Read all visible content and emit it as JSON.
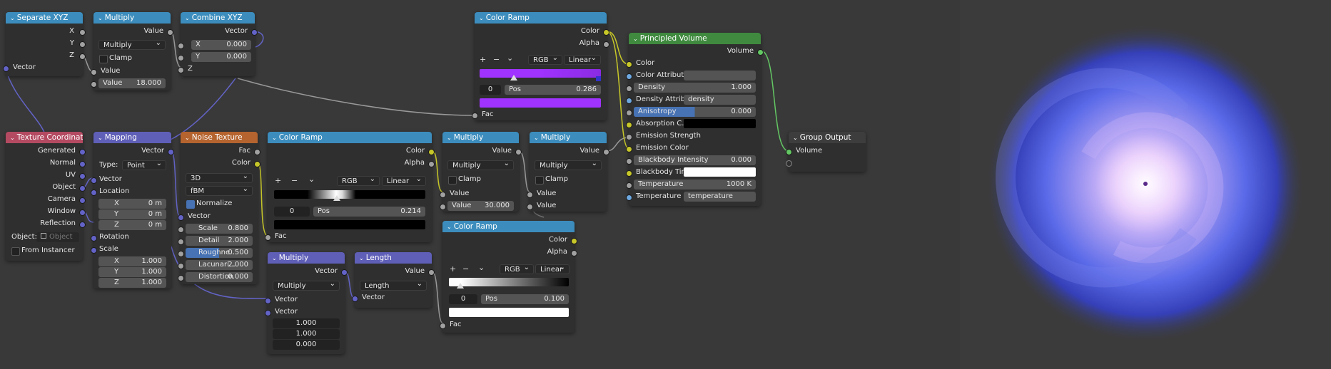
{
  "colors": {
    "conv_header": "#3c8dbd",
    "vector_header": "#5f5fb8",
    "texture_header": "#b5642f",
    "input_header": "#b44a62",
    "shader_header": "#3f8a3f",
    "output_header": "#3d3d3d",
    "socket_gray": "#a1a1a1",
    "socket_yellow": "#c7c729",
    "socket_vector": "#6363c7",
    "socket_shader": "#63c763",
    "ramp_purple": "#a033ff",
    "volume_blue": "#4d5be8",
    "volume_pink": "#f3d9ff"
  },
  "sepxyz": {
    "title": "Separate XYZ",
    "out_x": "X",
    "out_y": "Y",
    "out_z": "Z",
    "in_vector": "Vector"
  },
  "mul1": {
    "title": "Multiply",
    "out": "Value",
    "op": "Multiply",
    "clamp": "Clamp",
    "in_value": "Value",
    "value_label": "Value",
    "value": "18.000"
  },
  "combxyz": {
    "title": "Combine XYZ",
    "out": "Vector",
    "x_label": "X",
    "x": "0.000",
    "y_label": "Y",
    "y": "0.000",
    "in_z": "Z"
  },
  "ramp1": {
    "title": "Color Ramp",
    "out_color": "Color",
    "out_alpha": "Alpha",
    "add": "+",
    "remove": "−",
    "menu": "⌄",
    "mode": "RGB",
    "interp": "Linear",
    "index": "0",
    "pos_label": "Pos",
    "pos": "0.286",
    "in_fac": "Fac"
  },
  "pvol": {
    "title": "Principled Volume",
    "out": "Volume",
    "color": "Color",
    "color_attr": "Color Attribute",
    "density_label": "Density",
    "density": "1.000",
    "density_attr_label": "Density Attrib...",
    "density_attr": "density",
    "anisotropy_label": "Anisotropy",
    "anisotropy": "0.000",
    "absorption": "Absorption C...",
    "emission_strength": "Emission Strength",
    "emission_color": "Emission Color",
    "bb_intensity_label": "Blackbody Intensity",
    "bb_intensity": "0.000",
    "bb_tint": "Blackbody Tint",
    "temperature_label": "Temperature",
    "temperature": "1000 K",
    "temp_attr_label": "Temperature ...",
    "temp_attr": "temperature"
  },
  "groupout": {
    "title": "Group Output",
    "in_volume": "Volume"
  },
  "texcoord": {
    "title": "Texture Coordinate",
    "outs": [
      "Generated",
      "Normal",
      "UV",
      "Object",
      "Camera",
      "Window",
      "Reflection"
    ],
    "object_label": "Object:",
    "object_placeholder": "Object",
    "from_instancer": "From Instancer"
  },
  "mapping": {
    "title": "Mapping",
    "out": "Vector",
    "type_label": "Type:",
    "type": "Point",
    "in_vector": "Vector",
    "location": "Location",
    "loc": [
      {
        "label": "X",
        "value": "0 m"
      },
      {
        "label": "Y",
        "value": "0 m"
      },
      {
        "label": "Z",
        "value": "0 m"
      }
    ],
    "rotation": "Rotation",
    "scale": "Scale",
    "scl": [
      {
        "label": "X",
        "value": "1.000"
      },
      {
        "label": "Y",
        "value": "1.000"
      },
      {
        "label": "Z",
        "value": "1.000"
      }
    ]
  },
  "noise": {
    "title": "Noise Texture",
    "out_fac": "Fac",
    "out_color": "Color",
    "dim": "3D",
    "type": "fBM",
    "normalize": "Normalize",
    "in_vector": "Vector",
    "fields": [
      {
        "label": "Scale",
        "value": "0.800"
      },
      {
        "label": "Detail",
        "value": "2.000"
      },
      {
        "label": "Roughne...",
        "value": "0.500"
      },
      {
        "label": "Lacunari...",
        "value": "2.000"
      },
      {
        "label": "Distortion",
        "value": "0.000"
      }
    ]
  },
  "ramp2": {
    "title": "Color Ramp",
    "out_color": "Color",
    "out_alpha": "Alpha",
    "add": "+",
    "remove": "−",
    "menu": "⌄",
    "mode": "RGB",
    "interp": "Linear",
    "index": "0",
    "pos_label": "Pos",
    "pos": "0.214",
    "in_fac": "Fac"
  },
  "mul2": {
    "title": "Multiply",
    "out": "Value",
    "op": "Multiply",
    "clamp": "Clamp",
    "in_value": "Value",
    "value_label": "Value",
    "value": "30.000"
  },
  "mul3": {
    "title": "Multiply",
    "out": "Value",
    "op": "Multiply",
    "clamp": "Clamp",
    "in_value1": "Value",
    "in_value2": "Value"
  },
  "vmul": {
    "title": "Multiply",
    "out": "Vector",
    "op": "Multiply",
    "in_vector1": "Vector",
    "in_vector2": "Vector",
    "vals": [
      "1.000",
      "1.000",
      "0.000"
    ]
  },
  "length": {
    "title": "Length",
    "out": "Value",
    "op": "Length",
    "in_vector": "Vector"
  },
  "ramp3": {
    "title": "Color Ramp",
    "out_color": "Color",
    "out_alpha": "Alpha",
    "add": "+",
    "remove": "−",
    "menu": "⌄",
    "mode": "RGB",
    "interp": "Linear",
    "index": "0",
    "pos_label": "Pos",
    "pos": "0.100",
    "in_fac": "Fac"
  }
}
